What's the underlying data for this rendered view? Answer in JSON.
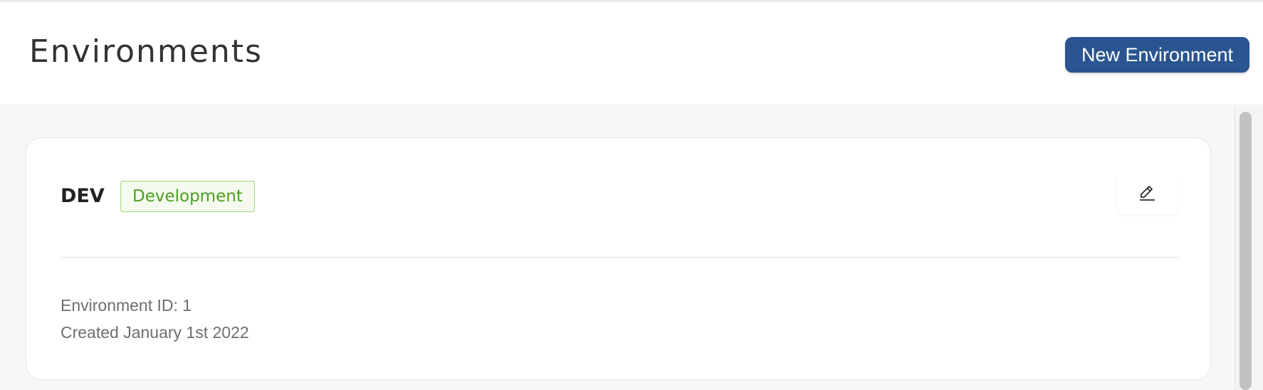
{
  "header": {
    "title": "Environments",
    "new_button_label": "New Environment"
  },
  "environments": [
    {
      "name": "DEV",
      "badge": "Development",
      "id_text": "Environment ID: 1",
      "created_text": "Created January 1st 2022",
      "edit_icon": "pencil-icon"
    }
  ],
  "colors": {
    "primary": "#2b5591",
    "badge_text": "#4c9e1f",
    "badge_border": "#9fd77c",
    "badge_bg": "#f4fbee",
    "content_bg": "#f7f7f7"
  }
}
